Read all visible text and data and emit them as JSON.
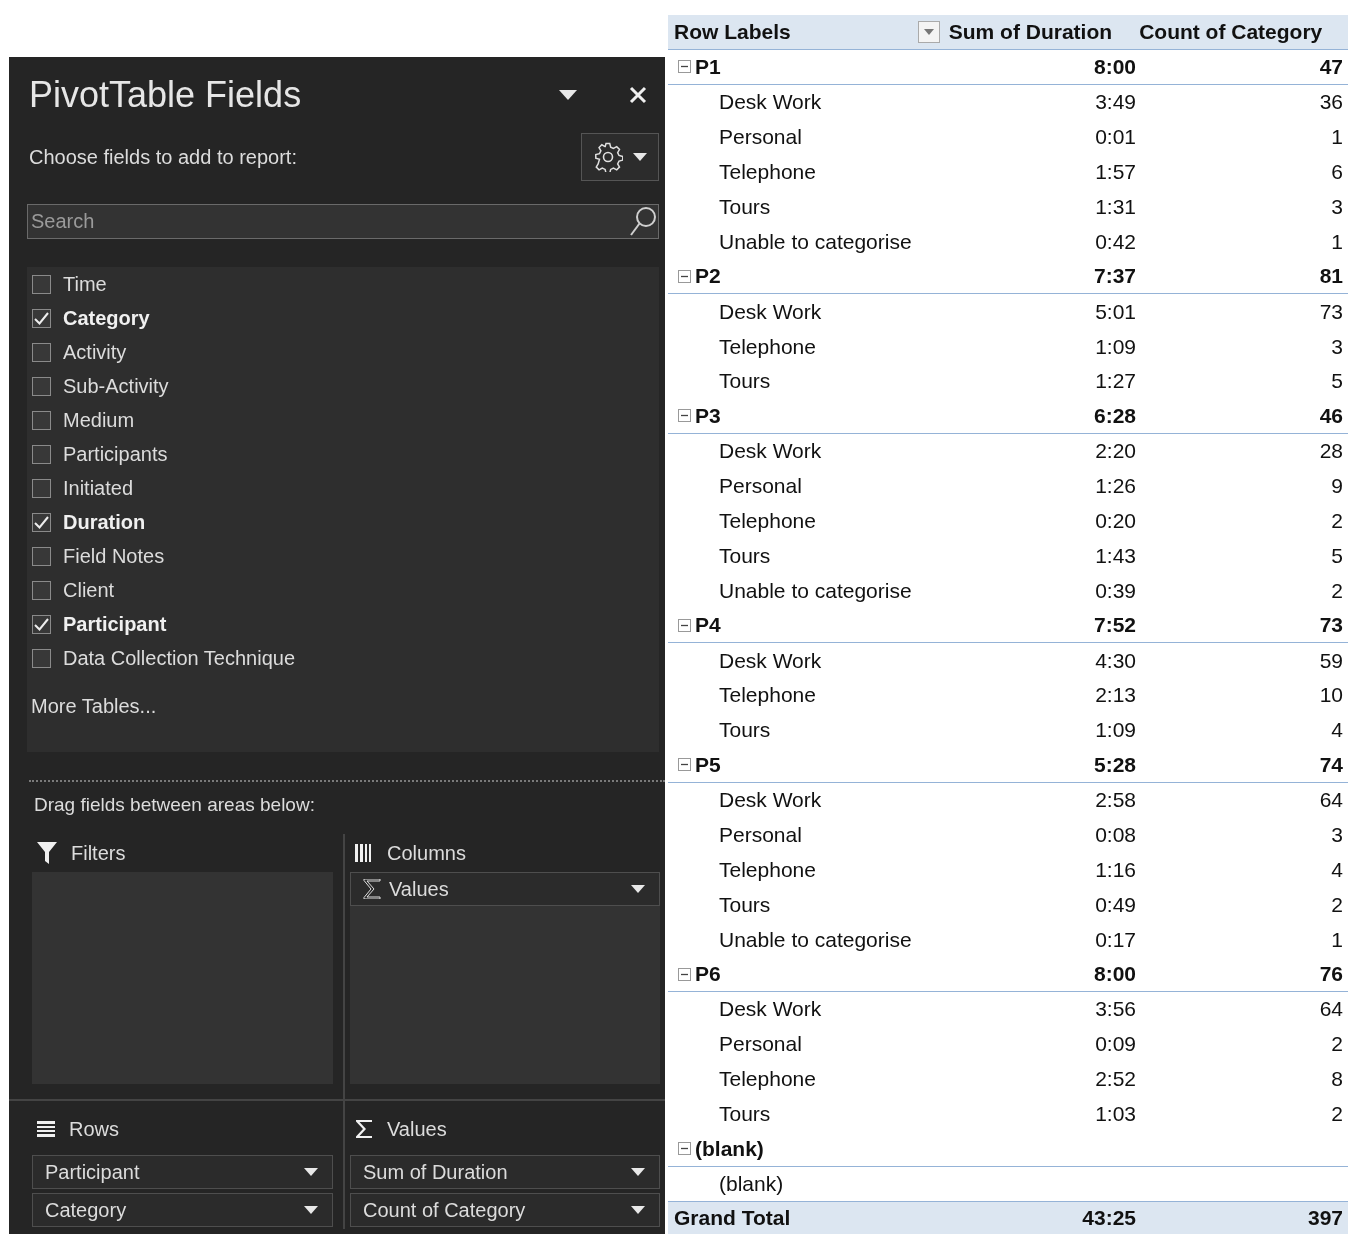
{
  "panel": {
    "title": "PivotTable Fields",
    "subtitle": "Choose fields to add to report:",
    "search": {
      "placeholder": "Search"
    },
    "fields": [
      {
        "label": "Time",
        "checked": false
      },
      {
        "label": "Category",
        "checked": true
      },
      {
        "label": "Activity",
        "checked": false
      },
      {
        "label": "Sub-Activity",
        "checked": false
      },
      {
        "label": "Medium",
        "checked": false
      },
      {
        "label": "Participants",
        "checked": false
      },
      {
        "label": "Initiated",
        "checked": false
      },
      {
        "label": "Duration",
        "checked": true
      },
      {
        "label": "Field Notes",
        "checked": false
      },
      {
        "label": "Client",
        "checked": false
      },
      {
        "label": "Participant",
        "checked": true
      },
      {
        "label": "Data Collection Technique",
        "checked": false
      }
    ],
    "more_tables": "More Tables...",
    "drag_hint": "Drag fields between areas below:",
    "areas": [
      {
        "kind": "filters",
        "label": "Filters"
      },
      {
        "kind": "columns",
        "label": "Columns",
        "items": [
          {
            "label": "Values",
            "kind": "values"
          }
        ]
      },
      {
        "kind": "rows",
        "label": "Rows",
        "items": [
          {
            "label": "Participant",
            "kind": "field"
          },
          {
            "label": "Category",
            "kind": "field"
          }
        ]
      },
      {
        "kind": "values",
        "label": "Values",
        "items": [
          {
            "label": "Sum of Duration",
            "kind": "field"
          },
          {
            "label": "Count of Category",
            "kind": "field"
          }
        ]
      }
    ]
  },
  "pivot": {
    "columns": [
      "Row Labels",
      "Sum of Duration",
      "Count of Category"
    ],
    "groups": [
      {
        "label": "P1",
        "expanded": true,
        "sum": "8:00",
        "count": "47",
        "children": [
          {
            "label": "Desk Work",
            "sum": "3:49",
            "count": "36"
          },
          {
            "label": "Personal",
            "sum": "0:01",
            "count": "1"
          },
          {
            "label": "Telephone",
            "sum": "1:57",
            "count": "6"
          },
          {
            "label": "Tours",
            "sum": "1:31",
            "count": "3"
          },
          {
            "label": "Unable to categorise",
            "sum": "0:42",
            "count": "1"
          }
        ]
      },
      {
        "label": "P2",
        "expanded": true,
        "sum": "7:37",
        "count": "81",
        "children": [
          {
            "label": "Desk Work",
            "sum": "5:01",
            "count": "73"
          },
          {
            "label": "Telephone",
            "sum": "1:09",
            "count": "3"
          },
          {
            "label": "Tours",
            "sum": "1:27",
            "count": "5"
          }
        ]
      },
      {
        "label": "P3",
        "expanded": true,
        "sum": "6:28",
        "count": "46",
        "children": [
          {
            "label": "Desk Work",
            "sum": "2:20",
            "count": "28"
          },
          {
            "label": "Personal",
            "sum": "1:26",
            "count": "9"
          },
          {
            "label": "Telephone",
            "sum": "0:20",
            "count": "2"
          },
          {
            "label": "Tours",
            "sum": "1:43",
            "count": "5"
          },
          {
            "label": "Unable to categorise",
            "sum": "0:39",
            "count": "2"
          }
        ]
      },
      {
        "label": "P4",
        "expanded": true,
        "sum": "7:52",
        "count": "73",
        "children": [
          {
            "label": "Desk Work",
            "sum": "4:30",
            "count": "59"
          },
          {
            "label": "Telephone",
            "sum": "2:13",
            "count": "10"
          },
          {
            "label": "Tours",
            "sum": "1:09",
            "count": "4"
          }
        ]
      },
      {
        "label": "P5",
        "expanded": true,
        "sum": "5:28",
        "count": "74",
        "children": [
          {
            "label": "Desk Work",
            "sum": "2:58",
            "count": "64"
          },
          {
            "label": "Personal",
            "sum": "0:08",
            "count": "3"
          },
          {
            "label": "Telephone",
            "sum": "1:16",
            "count": "4"
          },
          {
            "label": "Tours",
            "sum": "0:49",
            "count": "2"
          },
          {
            "label": "Unable to categorise",
            "sum": "0:17",
            "count": "1"
          }
        ]
      },
      {
        "label": "P6",
        "expanded": true,
        "sum": "8:00",
        "count": "76",
        "children": [
          {
            "label": "Desk Work",
            "sum": "3:56",
            "count": "64"
          },
          {
            "label": "Personal",
            "sum": "0:09",
            "count": "2"
          },
          {
            "label": "Telephone",
            "sum": "2:52",
            "count": "8"
          },
          {
            "label": "Tours",
            "sum": "1:03",
            "count": "2"
          }
        ]
      },
      {
        "label": "(blank)",
        "expanded": true,
        "children": [
          {
            "label": "(blank)"
          }
        ]
      }
    ],
    "grand_total": {
      "label": "Grand Total",
      "sum": "43:25",
      "count": "397"
    }
  }
}
